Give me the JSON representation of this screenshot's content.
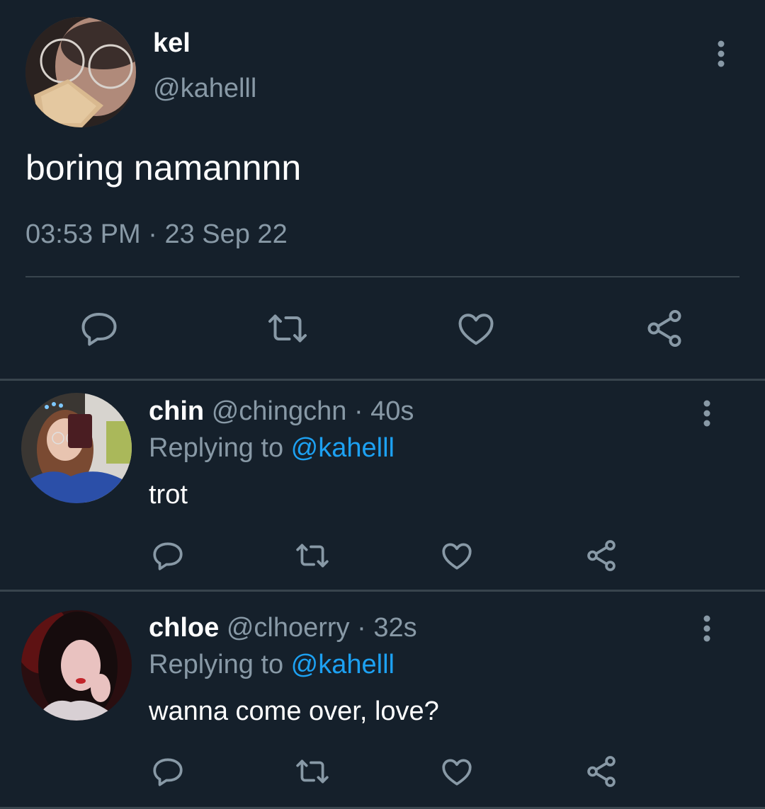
{
  "main_tweet": {
    "name": "kel",
    "handle": "@kahelll",
    "text": "boring namannnn",
    "time": "03:53 PM",
    "separator": "·",
    "date": "23 Sep 22",
    "icons": [
      "reply-icon",
      "retweet-icon",
      "like-icon",
      "share-icon",
      "more-icon"
    ]
  },
  "replies": [
    {
      "name": "chin",
      "handle": "@chingchn",
      "separator": "·",
      "time": "40s",
      "replying_prefix": "Replying to ",
      "replying_mention": "@kahelll",
      "text": "trot"
    },
    {
      "name": "chloe",
      "handle": "@clhoerry",
      "separator": "·",
      "time": "32s",
      "replying_prefix": "Replying to ",
      "replying_mention": "@kahelll",
      "text": "wanna come over, love?"
    }
  ],
  "colors": {
    "background": "#15202b",
    "divider": "#38444d",
    "secondary_text": "#8899a6",
    "mention": "#1da1f2",
    "primary_text": "#ffffff"
  }
}
